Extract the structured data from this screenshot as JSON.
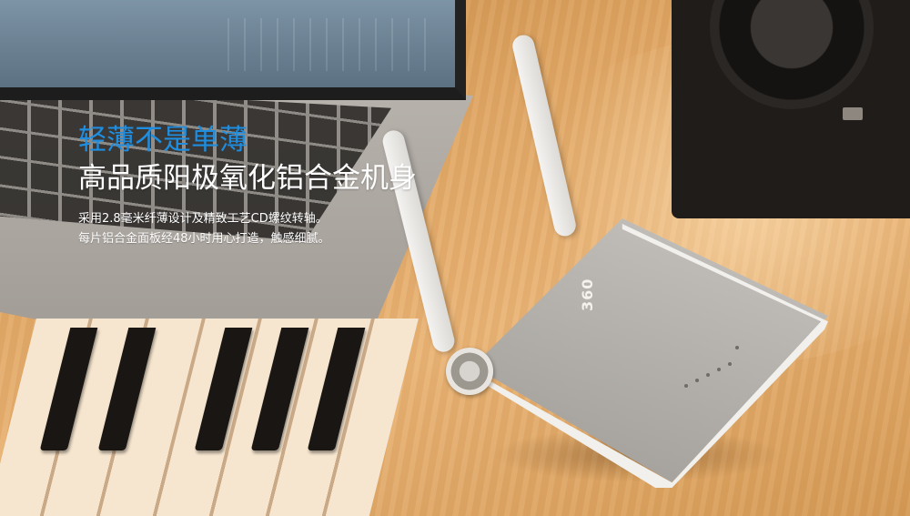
{
  "headline": {
    "line1": "轻薄不是单薄",
    "line2": "高品质阳极氧化铝合金机身"
  },
  "description": {
    "line1": "采用2.8毫米纤薄设计及精致工艺CD螺纹转轴。",
    "line2": "每片铝合金面板经48小时用心打造，触感细腻。"
  },
  "colors": {
    "accent_blue": "#1f8ee0",
    "body_text": "#ffffff"
  }
}
